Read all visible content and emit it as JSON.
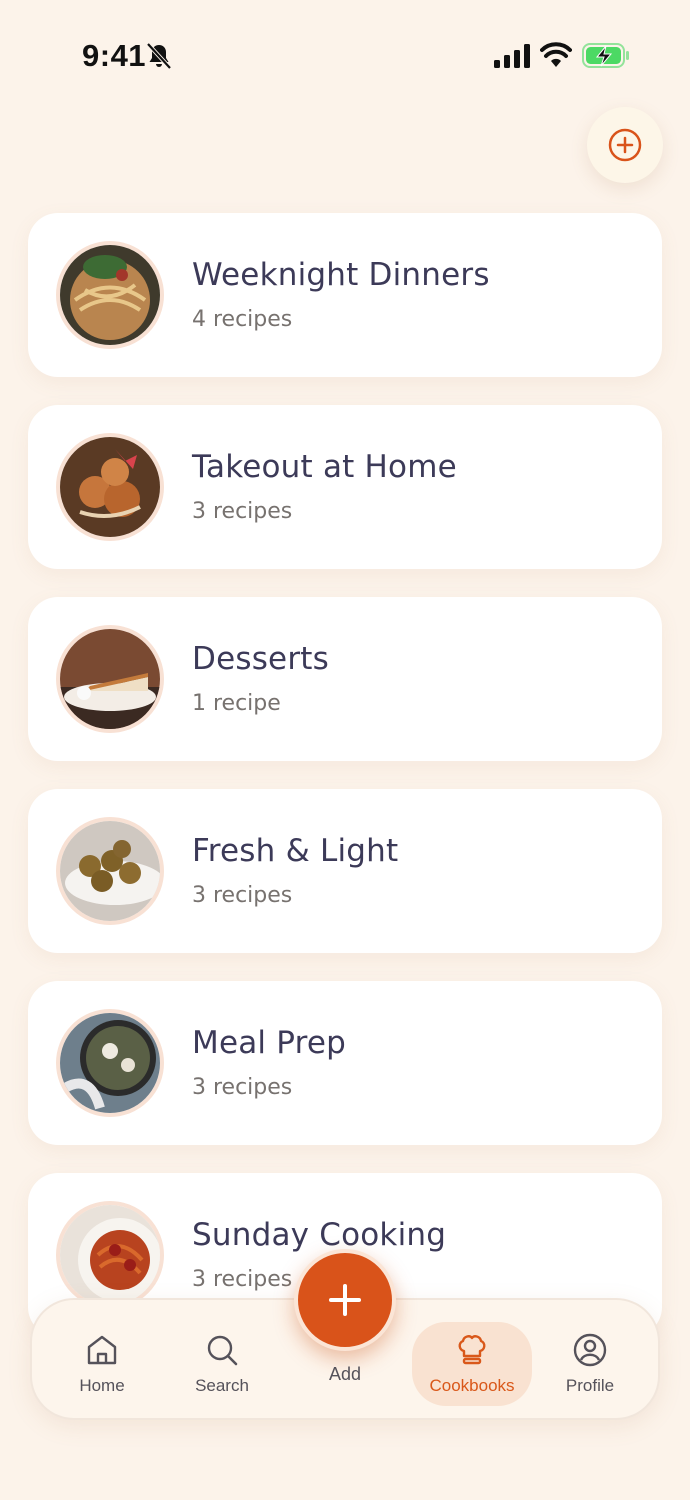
{
  "status": {
    "time": "9:41",
    "icons": [
      "bell-off-icon",
      "signal-icon",
      "wifi-icon",
      "battery-charging-icon"
    ]
  },
  "colors": {
    "background": "#fcf3ea",
    "accent": "#d9531a",
    "card": "#ffffff",
    "title": "#3c3a58",
    "battery": "#4cd964"
  },
  "header": {
    "add_icon": "plus-circle-icon"
  },
  "cookbooks": [
    {
      "title": "Weeknight Dinners",
      "count": "4 recipes",
      "image": "noodle-dish"
    },
    {
      "title": "Takeout at Home",
      "count": "3 recipes",
      "image": "crispy-dish"
    },
    {
      "title": "Desserts",
      "count": "1 recipe",
      "image": "cheesecake-slice"
    },
    {
      "title": "Fresh & Light",
      "count": "3 recipes",
      "image": "falafel-plate"
    },
    {
      "title": "Meal Prep",
      "count": "3 recipes",
      "image": "skillet-dish"
    },
    {
      "title": "Sunday Cooking",
      "count": "3 recipes",
      "image": "spaghetti-plate"
    }
  ],
  "tabbar": {
    "home": "Home",
    "search": "Search",
    "add": "Add",
    "cookbooks": "Cookbooks",
    "profile": "Profile",
    "active": "cookbooks"
  }
}
